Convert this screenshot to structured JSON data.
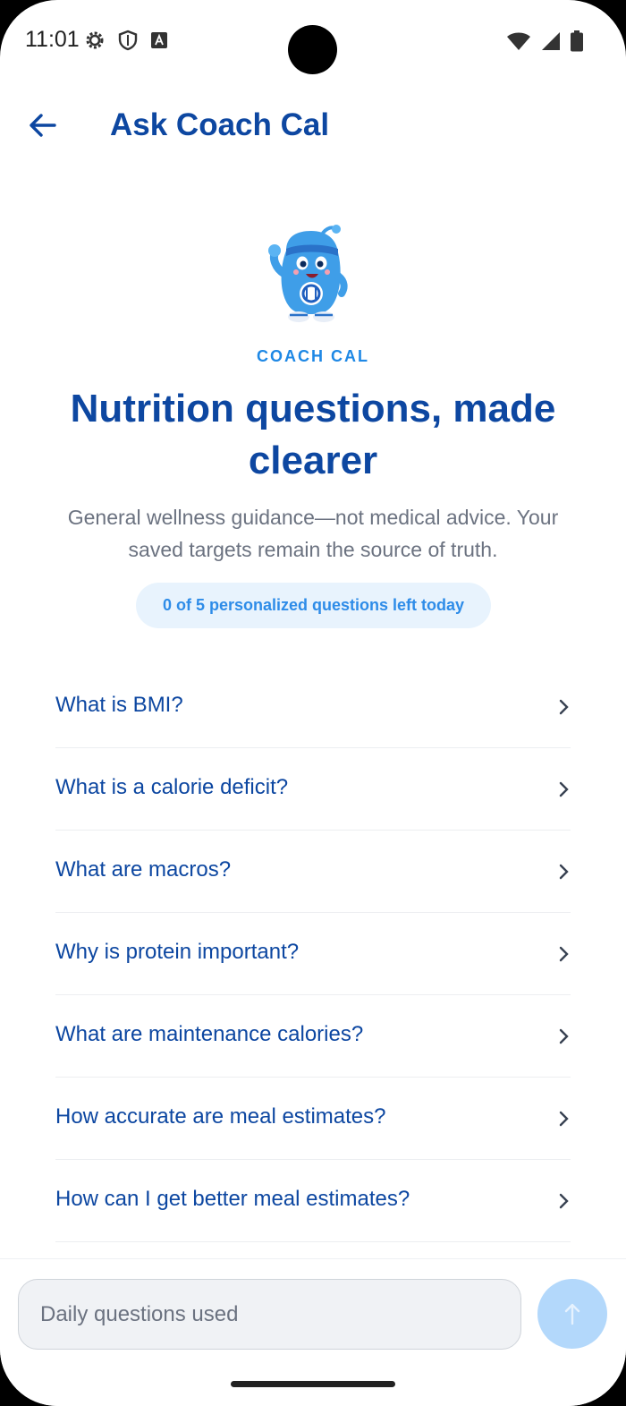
{
  "status_bar": {
    "time": "11:01",
    "icons_left": [
      "settings-icon",
      "shield-icon",
      "text-a-icon"
    ],
    "icons_right": [
      "wifi-icon",
      "signal-icon",
      "battery-icon"
    ]
  },
  "app_bar": {
    "back_icon": "arrow-left-icon",
    "title": "Ask Coach Cal"
  },
  "hero": {
    "mascot": "coach-cal-mascot",
    "tag": "COACH CAL",
    "headline": "Nutrition questions, made clearer",
    "subtext": "General wellness guidance—not medical advice. Your saved targets remain the source of truth.",
    "quota": "0 of 5 personalized questions left today"
  },
  "questions": [
    {
      "label": "What is BMI?"
    },
    {
      "label": "What is a calorie deficit?"
    },
    {
      "label": "What are macros?"
    },
    {
      "label": "Why is protein important?"
    },
    {
      "label": "What are maintenance calories?"
    },
    {
      "label": "How accurate are meal estimates?"
    },
    {
      "label": "How can I get better meal estimates?"
    }
  ],
  "composer": {
    "placeholder": "Daily questions used",
    "send_icon": "arrow-up-icon"
  },
  "colors": {
    "primary": "#0d47a1",
    "accent": "#1e88e5",
    "pill_bg": "#e8f3fd",
    "send_disabled": "#b3d8fb"
  }
}
